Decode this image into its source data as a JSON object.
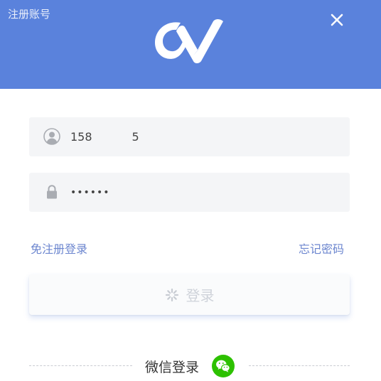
{
  "header": {
    "register_label": "注册账号",
    "bg_color": "#5a82dc"
  },
  "form": {
    "phone_value": "158           5",
    "password_value": "••••••"
  },
  "links": {
    "free_register_login": "免注册登录",
    "forgot_password": "忘记密码"
  },
  "login_button": {
    "label": "登录",
    "state": "loading"
  },
  "wechat": {
    "label": "微信登录",
    "color": "#2dc100"
  },
  "icons": {
    "close": "close-icon",
    "user": "user-icon",
    "lock": "lock-icon",
    "spinner": "spinner-icon",
    "wechat": "wechat-icon"
  }
}
